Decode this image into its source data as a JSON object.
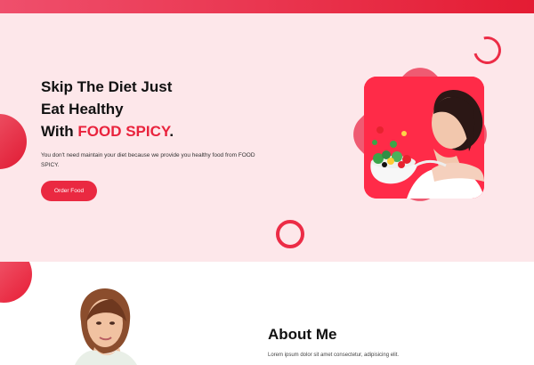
{
  "hero": {
    "headline_line1": "Skip The Diet Just",
    "headline_line2": "Eat Healthy",
    "headline_line3_prefix": "With ",
    "headline_brand": "FOOD SPICY",
    "headline_line3_suffix": ".",
    "description": "You don't need maintain your diet because we provide you healthy food from FOOD SPICY.",
    "cta_label": "Order Food"
  },
  "about": {
    "title": "About Me",
    "text": "Lorem ipsum dolor sit amet consectetur, adipisicing elit."
  },
  "colors": {
    "accent": "#e9233d",
    "hero_bg": "#fde7ea",
    "button": "#ea2941",
    "diamond": "#ef5b72",
    "photo_bg": "#ff2b48"
  }
}
